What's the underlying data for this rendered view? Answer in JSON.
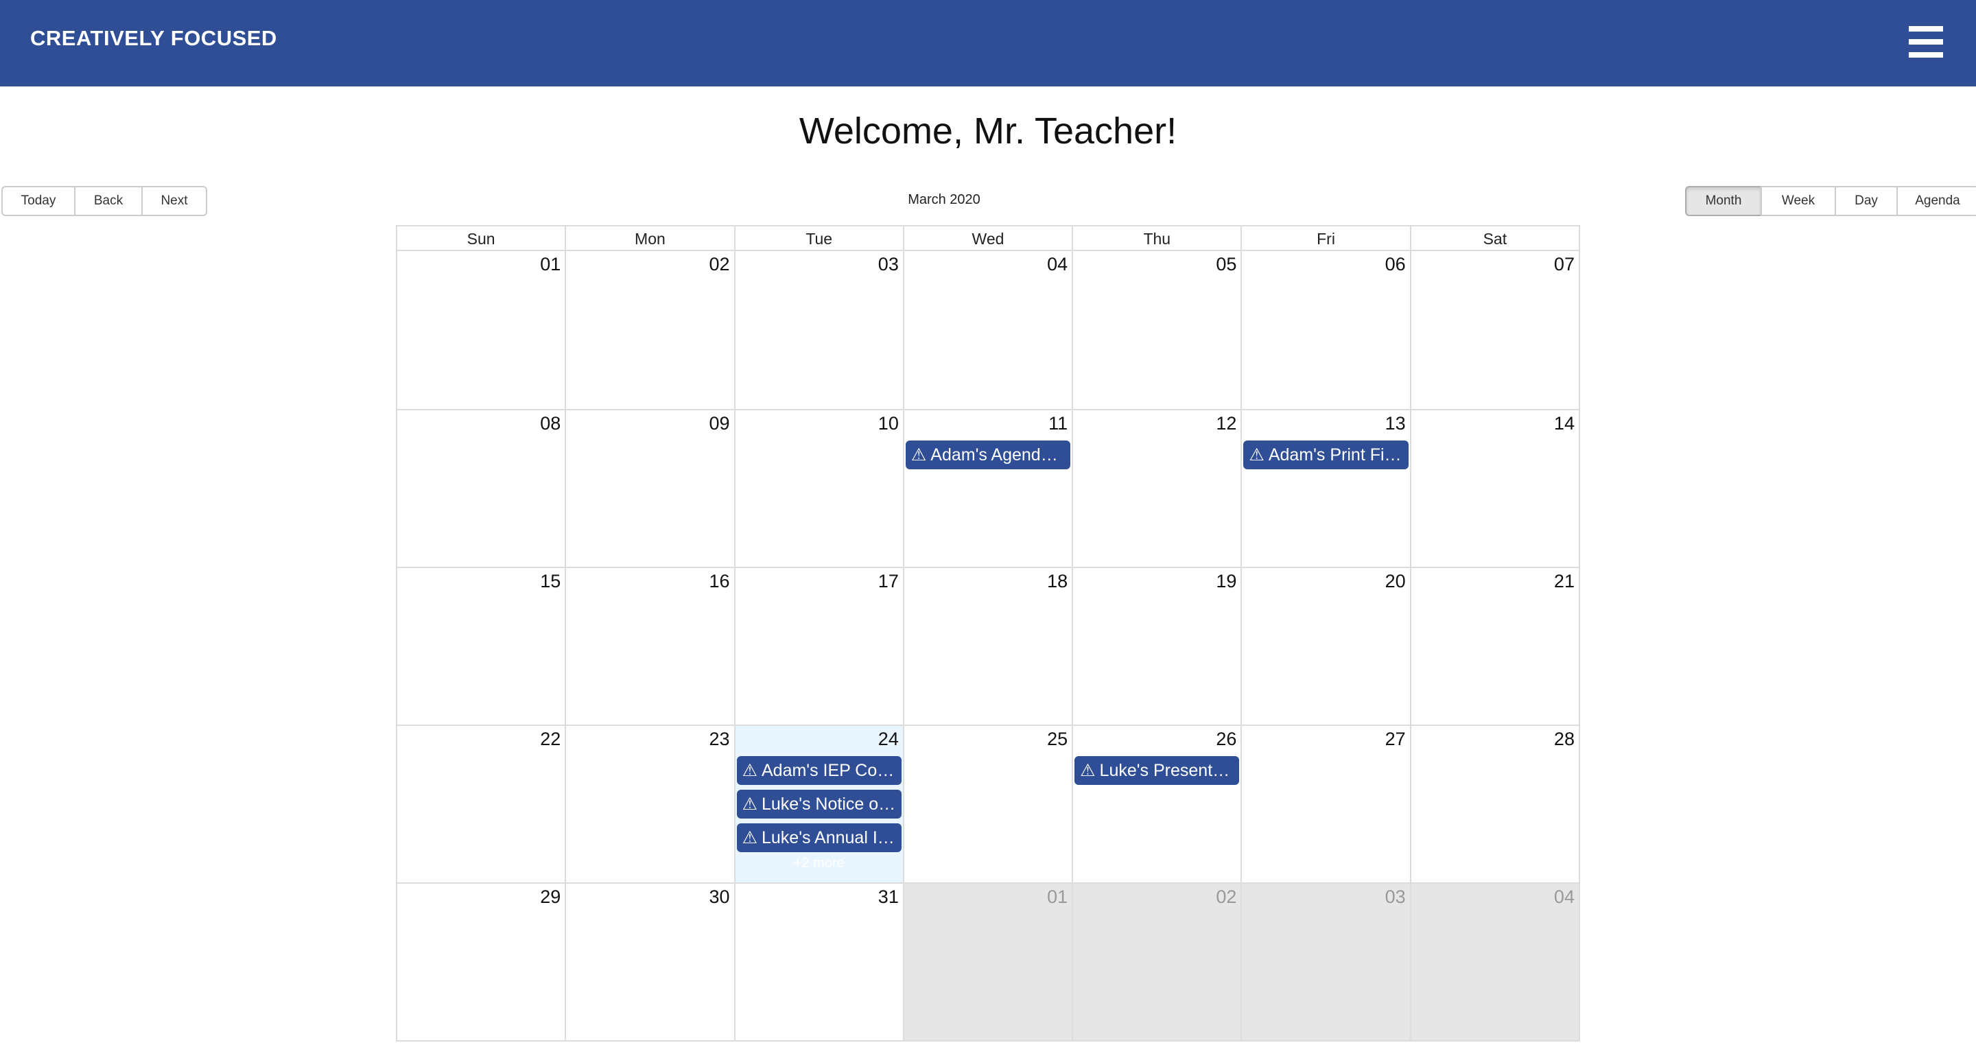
{
  "header": {
    "brand": "CREATIVELY FOCUSED",
    "menu_icon": "hamburger-menu-icon"
  },
  "welcome": "Welcome, Mr. Teacher!",
  "toolbar": {
    "nav": [
      "Today",
      "Back",
      "Next"
    ],
    "label": "March 2020",
    "views": [
      "Month",
      "Week",
      "Day",
      "Agenda"
    ],
    "active_view": "Month"
  },
  "calendar": {
    "weekdays": [
      "Sun",
      "Mon",
      "Tue",
      "Wed",
      "Thu",
      "Fri",
      "Sat"
    ],
    "weeks": [
      [
        {
          "date": "01"
        },
        {
          "date": "02"
        },
        {
          "date": "03"
        },
        {
          "date": "04"
        },
        {
          "date": "05"
        },
        {
          "date": "06"
        },
        {
          "date": "07"
        }
      ],
      [
        {
          "date": "08"
        },
        {
          "date": "09"
        },
        {
          "date": "10"
        },
        {
          "date": "11",
          "events": [
            "Adam's Agenda a..."
          ]
        },
        {
          "date": "12"
        },
        {
          "date": "13",
          "events": [
            "Adam's Print Fin..."
          ]
        },
        {
          "date": "14"
        }
      ],
      [
        {
          "date": "15"
        },
        {
          "date": "16"
        },
        {
          "date": "17"
        },
        {
          "date": "18"
        },
        {
          "date": "19"
        },
        {
          "date": "20"
        },
        {
          "date": "21"
        }
      ],
      [
        {
          "date": "22"
        },
        {
          "date": "23"
        },
        {
          "date": "24",
          "today": true,
          "events": [
            "Adam's IEP Cons...",
            "Luke's Notice of ...",
            "Luke's Annual IE..."
          ],
          "more": "+2 more"
        },
        {
          "date": "25"
        },
        {
          "date": "26",
          "events": [
            "Luke's Present Le..."
          ]
        },
        {
          "date": "27"
        },
        {
          "date": "28"
        }
      ],
      [
        {
          "date": "29"
        },
        {
          "date": "30"
        },
        {
          "date": "31"
        },
        {
          "date": "01",
          "off": true
        },
        {
          "date": "02",
          "off": true
        },
        {
          "date": "03",
          "off": true
        },
        {
          "date": "04",
          "off": true
        }
      ]
    ]
  },
  "event_icon": "warning-triangle-icon",
  "colors": {
    "brand": "#2f4e96",
    "today_bg": "#eaf6ff",
    "off_range_bg": "#e6e6e6"
  }
}
